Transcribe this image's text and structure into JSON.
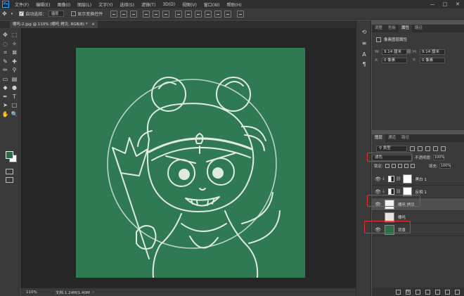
{
  "app": {
    "logo_text": "Ps"
  },
  "menu": [
    "文件(F)",
    "编辑(E)",
    "图像(I)",
    "图层(L)",
    "文字(Y)",
    "选择(S)",
    "滤镜(T)",
    "3D(D)",
    "视图(V)",
    "窗口(W)",
    "帮助(H)"
  ],
  "window_controls": {
    "minimize": "—",
    "maximize": "□",
    "close": "✕"
  },
  "options": {
    "auto_select_label": "自动选择：",
    "auto_select_checked": true,
    "auto_select_value": "图层",
    "transform_label": "显示变换控件",
    "transform_checked": false
  },
  "document_tab": {
    "label": "哪吒-2.jpg @ 110% (哪吒 拷贝, RGB/8) *",
    "close": "×"
  },
  "tools_left": [
    {
      "name": "move-icon",
      "glyph": "✥"
    },
    {
      "name": "lasso-icon",
      "glyph": "◌"
    },
    {
      "name": "crop-icon",
      "glyph": "⌗"
    },
    {
      "name": "eyedropper-icon",
      "glyph": "✎"
    },
    {
      "name": "brush-icon",
      "glyph": "✏"
    },
    {
      "name": "eraser-icon",
      "glyph": "▭"
    },
    {
      "name": "blur-icon",
      "glyph": "◆"
    },
    {
      "name": "pen-icon",
      "glyph": "✒"
    },
    {
      "name": "path-select-icon",
      "glyph": "➤"
    },
    {
      "name": "hand-icon",
      "glyph": "✋"
    }
  ],
  "tools_right": [
    {
      "name": "marquee-icon",
      "glyph": "⬚"
    },
    {
      "name": "quick-select-icon",
      "glyph": "✧"
    },
    {
      "name": "frame-icon",
      "glyph": "⊠"
    },
    {
      "name": "healing-icon",
      "glyph": "✚"
    },
    {
      "name": "stamp-icon",
      "glyph": "⚲"
    },
    {
      "name": "gradient-icon",
      "glyph": "▤"
    },
    {
      "name": "dodge-icon",
      "glyph": "●"
    },
    {
      "name": "type-icon",
      "glyph": "T"
    },
    {
      "name": "rectangle-icon",
      "glyph": "□"
    },
    {
      "name": "zoom-icon",
      "glyph": "🔍"
    }
  ],
  "colors": {
    "foreground": "#2f6b47",
    "background": "#ffffff",
    "canvas": "#2f7a52",
    "highlight": "#e53030"
  },
  "status": {
    "zoom": "110%",
    "doc": "文档:1.24M/1.40M",
    "arrow": "›"
  },
  "properties": {
    "tabs": [
      "调整",
      "色板",
      "属性",
      "路径"
    ],
    "active_tab": 2,
    "title": "像素图层属性",
    "w_label": "W:",
    "w_value": "9.14 厘米",
    "h_label": "H:",
    "h_value": "9.14 厘米",
    "x_label": "X:",
    "x_value": "0 像素",
    "y_label": "Y:",
    "y_value": "0 像素"
  },
  "layers_panel": {
    "tabs": [
      "图层",
      "通道",
      "路径"
    ],
    "active_tab": 0,
    "filter": "类型",
    "blend_mode": "滤色",
    "opacity_label": "不透明度:",
    "opacity": "100%",
    "lock_label": "锁定:",
    "fill_label": "填充:",
    "fill": "100%",
    "layers": [
      {
        "name": "黑白 1",
        "type": "adjustment",
        "visible": true
      },
      {
        "name": "反相 1",
        "type": "adjustment",
        "visible": true
      },
      {
        "name": "哪吒 拷贝",
        "type": "pixel",
        "visible": true,
        "selected": true
      },
      {
        "name": "哪吒",
        "type": "pixel",
        "visible": false
      },
      {
        "name": "背景",
        "type": "background",
        "visible": true
      }
    ],
    "footer_icons": [
      "link-icon",
      "fx-icon",
      "mask-icon",
      "adjustment-icon",
      "group-icon",
      "new-layer-icon",
      "trash-icon"
    ]
  }
}
